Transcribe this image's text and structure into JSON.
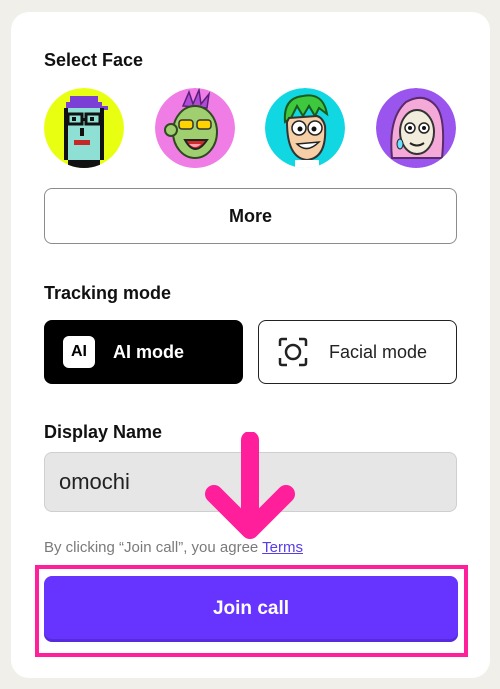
{
  "select_face": {
    "title": "Select Face",
    "faces": [
      {
        "name": "pixel-punk",
        "bg": "#e9ff12"
      },
      {
        "name": "green-ape",
        "bg": "#f07de5"
      },
      {
        "name": "cartoon-boy",
        "bg": "#11d7e3"
      },
      {
        "name": "pink-hair-girl",
        "bg": "#9b55ef"
      }
    ],
    "more_label": "More"
  },
  "tracking": {
    "title": "Tracking mode",
    "ai_icon_text": "AI",
    "ai_label": "AI mode",
    "facial_label": "Facial mode",
    "selected": "AI mode"
  },
  "display_name": {
    "title": "Display Name",
    "value": "omochi"
  },
  "terms": {
    "prefix": "By clicking “Join call”, you agree ",
    "link": "Terms"
  },
  "join_label": "Join call",
  "colors": {
    "accent": "#6633ff",
    "highlight": "#ff1f9a",
    "selected_mode_bg": "#000000"
  }
}
